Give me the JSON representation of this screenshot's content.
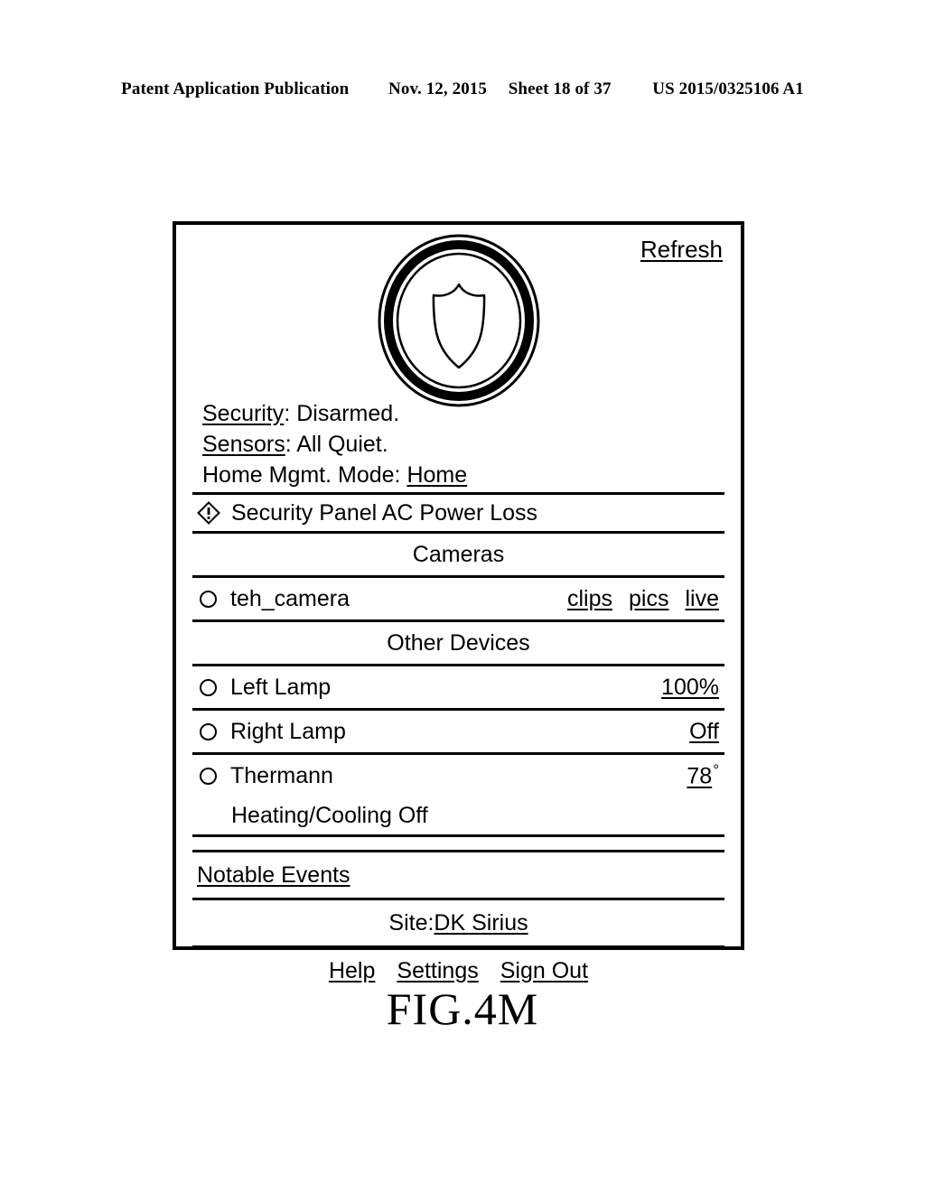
{
  "patent_header": {
    "publication": "Patent Application Publication",
    "date": "Nov. 12, 2015",
    "sheet": "Sheet 18 of 37",
    "number": "US 2015/0325106 A1"
  },
  "figure": {
    "caption": "FIG.4M"
  },
  "panel": {
    "refresh_label": "Refresh",
    "badge": {
      "icon": "shield-badge-icon"
    },
    "status": {
      "security_label": "Security",
      "security_sep": ": ",
      "security_value": "Disarmed.",
      "sensors_label": "Sensors",
      "sensors_sep": ": ",
      "sensors_value": "All Quiet.",
      "mode_label": "Home Mgmt. Mode: ",
      "mode_value": "Home"
    },
    "alert": {
      "icon": "warning-diamond-icon",
      "text": "Security Panel AC Power Loss"
    },
    "cameras": {
      "section_title": "Cameras",
      "items": [
        {
          "icon": "radio-circle-icon",
          "name": "teh_camera",
          "actions": [
            "clips",
            "pics",
            "live"
          ]
        }
      ]
    },
    "other_devices": {
      "section_title": "Other Devices",
      "items": [
        {
          "icon": "radio-circle-icon",
          "name": "Left Lamp",
          "value": "100%"
        },
        {
          "icon": "radio-circle-icon",
          "name": "Right Lamp",
          "value": "Off"
        },
        {
          "icon": "radio-circle-icon",
          "name": "Thermann",
          "value": "78",
          "value_suffix": "°"
        }
      ],
      "hvac_status": "Heating/Cooling Off"
    },
    "notable_events_label": "Notable Events",
    "site": {
      "prefix": "Site: ",
      "value": "DK Sirius"
    },
    "footer_links": [
      "Help",
      "Settings",
      "Sign Out"
    ]
  },
  "colors": {
    "ink": "#000000",
    "paper": "#ffffff"
  }
}
